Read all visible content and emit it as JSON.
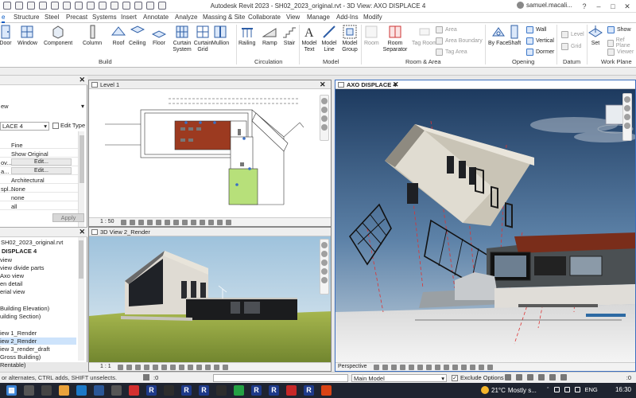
{
  "window": {
    "title": "Autodesk Revit 2023 - SH02_2023_original.rvt - 3D View: AXO DISPLACE 4",
    "user": "samuel.macali..."
  },
  "tabs": [
    {
      "label": "e"
    },
    {
      "label": "Structure"
    },
    {
      "label": "Steel"
    },
    {
      "label": "Precast"
    },
    {
      "label": "Systems"
    },
    {
      "label": "Insert"
    },
    {
      "label": "Annotate"
    },
    {
      "label": "Analyze"
    },
    {
      "label": "Massing & Site"
    },
    {
      "label": "Collaborate"
    },
    {
      "label": "View"
    },
    {
      "label": "Manage"
    },
    {
      "label": "Add-Ins"
    },
    {
      "label": "Modify"
    }
  ],
  "ribbon": {
    "build": {
      "door": "Door",
      "window": "Window",
      "component": "Component",
      "column": "Column",
      "roof": "Roof",
      "ceiling": "Ceiling",
      "floor": "Floor",
      "curtain_system": "Curtain System",
      "curtain_grid": "Curtain Grid",
      "mullion": "Mullion"
    },
    "circulation": {
      "railing": "Railing",
      "ramp": "Ramp",
      "stair": "Stair"
    },
    "model": {
      "model_text": "Model Text",
      "model_line": "Model Line",
      "model_group": "Model Group"
    },
    "room_area": {
      "room": "Room",
      "room_separator": "Room Separator",
      "tag_room": "Tag Room",
      "area": "Area",
      "area_boundary": "Area Boundary",
      "tag_area": "Tag Area"
    },
    "opening": {
      "by_face": "By Face",
      "shaft": "Shaft",
      "wall": "Wall",
      "vertical": "Vertical",
      "dormer": "Dormer"
    },
    "datum": {
      "level": "Level",
      "grid": "Grid"
    },
    "work_plane": {
      "set": "Set",
      "show": "Show",
      "ref_plane": "Ref Plane",
      "viewer": "Viewer"
    },
    "groups": {
      "build": "Build",
      "circulation": "Circulation",
      "model": "Model",
      "room_area": "Room & Area",
      "opening": "Opening",
      "datum": "Datum",
      "work_plane": "Work Plane"
    }
  },
  "properties": {
    "label_w": "ew",
    "type_selector": "LACE 4",
    "edit_type": "Edit Type",
    "rows": [
      {
        "key": "",
        "val": "Fine"
      },
      {
        "key": "",
        "val": "Show Original"
      },
      {
        "key": "ov...",
        "val": "Edit..."
      },
      {
        "key": "a...",
        "val": "Edit..."
      },
      {
        "key": "",
        "val": "Architectural"
      },
      {
        "key": "spl...",
        "val": "None"
      },
      {
        "key": "",
        "val": "none"
      },
      {
        "key": "",
        "val": "all"
      }
    ],
    "apply": "Apply"
  },
  "project_browser": {
    "items": [
      {
        "text": "SH02_2023_original.rvt"
      },
      {
        "text": "DISPLACE 4",
        "bold": true
      },
      {
        "text": "view"
      },
      {
        "text": "view divide parts"
      },
      {
        "text": "Axo view"
      },
      {
        "text": "en detail"
      },
      {
        "text": "erial view"
      },
      {
        "text": ""
      },
      {
        "text": "Building Elevation)"
      },
      {
        "text": "uilding Section)"
      },
      {
        "text": ""
      },
      {
        "text": "iew 1_Render"
      },
      {
        "text": "iew 2_Render",
        "highlight": true
      },
      {
        "text": "iew 3_render_draft"
      },
      {
        "text": "Gross Building)"
      },
      {
        "text": "Rentable)"
      }
    ]
  },
  "views": {
    "level1": {
      "title": "Level 1",
      "scale": "1 : 50"
    },
    "render": {
      "title": "3D View 2_Render",
      "scale": "1 : 1"
    },
    "axo": {
      "title": "AXO DISPLACE 4",
      "mode": "Perspective"
    }
  },
  "status": {
    "message": "or alternates, CTRL adds, SHIFT unselects.",
    "model": "Main Model",
    "exclude": "Exclude Options",
    "check": "✓",
    "zero": ":0"
  },
  "taskbar": {
    "temp": "21°C",
    "weather": "Mostly s...",
    "lang": "ENG",
    "time": "16:30"
  }
}
